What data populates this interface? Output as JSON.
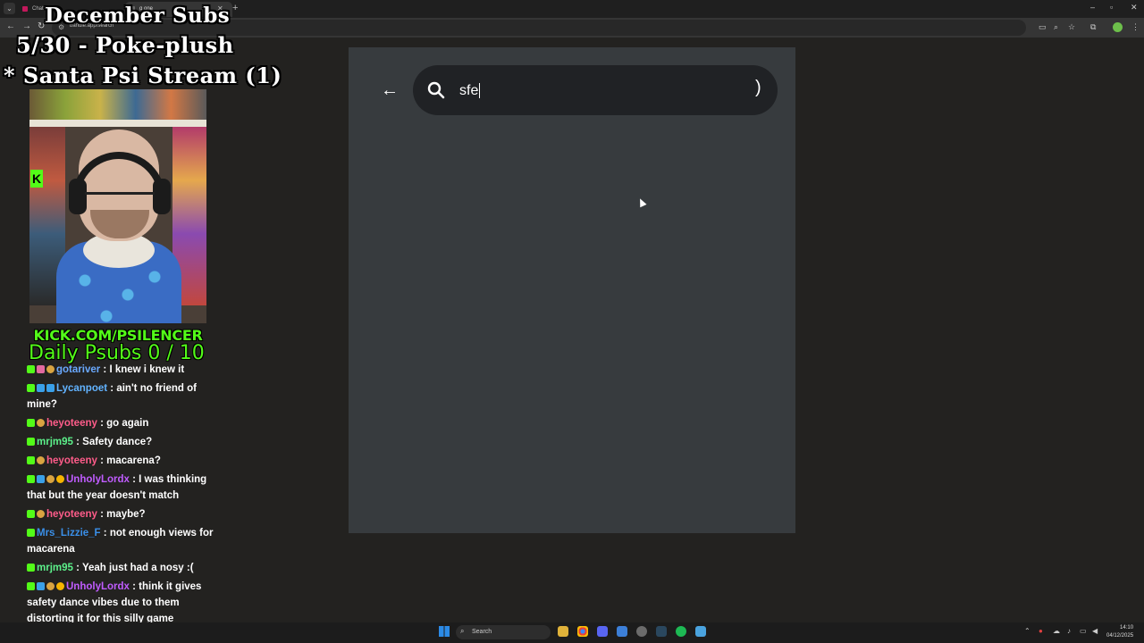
{
  "browser": {
    "tabs": [
      {
        "label": "Chat"
      },
      {
        "label": "g one"
      }
    ],
    "url": "bandle.app/search",
    "window_controls": {
      "minimize": "–",
      "maximize": "▫",
      "close": "✕"
    }
  },
  "overlay": {
    "line1": "December Subs",
    "line2": "5/30 - Poke-plush",
    "line3": "* Santa Psi Stream (1)",
    "kick_url": "KICK.COM/PSILENCER",
    "daily_psubs": "Daily Psubs 0 / 10"
  },
  "chat": {
    "messages": [
      {
        "user": "gotariver",
        "user_color": "#6aa9ff",
        "text": "I knew i knew it"
      },
      {
        "user": "Lycanpoet",
        "user_color": "#62b3ff",
        "text": "ain't no friend of mine?"
      },
      {
        "user": "heyoteeny",
        "user_color": "#ff5c8a",
        "text": "go again"
      },
      {
        "user": "mrjm95",
        "user_color": "#5cf08a",
        "text": "Safety dance?"
      },
      {
        "user": "heyoteeny",
        "user_color": "#ff5c8a",
        "text": "macarena?"
      },
      {
        "user": "UnholyLordx",
        "user_color": "#c05cff",
        "text": "I was thinking that but the year doesn't match"
      },
      {
        "user": "heyoteeny",
        "user_color": "#ff5c8a",
        "text": "maybe?"
      },
      {
        "user": "Mrs_Lizzie_F",
        "user_color": "#3a8fe8",
        "text": "not enough views for macarena"
      },
      {
        "user": "mrjm95",
        "user_color": "#5cf08a",
        "text": "Yeah just had a nosy :("
      },
      {
        "user": "UnholyLordx",
        "user_color": "#c05cff",
        "text": "think it gives safety dance vibes due to them distorting it for this silly game"
      }
    ]
  },
  "search": {
    "value": "sfe",
    "placeholder": "",
    "trailing": ")"
  },
  "taskbar": {
    "search_label": "Search",
    "time": "14:10",
    "date": "04/12/2025"
  }
}
